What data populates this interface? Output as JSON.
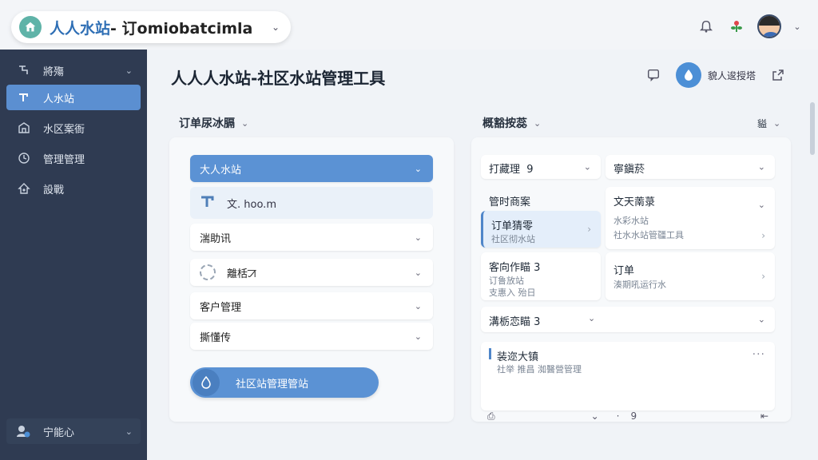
{
  "window": {
    "title_accent": "人人水站",
    "title_rest": "- 订omiobatcimla"
  },
  "sidebar": {
    "items": [
      {
        "label": "將殤",
        "icon": "tap-icon"
      },
      {
        "label": "人水站",
        "icon": "faucet-icon"
      },
      {
        "label": "水区案衙",
        "icon": "building-icon"
      },
      {
        "label": "管理管理",
        "icon": "clock-icon"
      },
      {
        "label": "設戰",
        "icon": "settings-icon"
      }
    ],
    "footer_label": "宁能心"
  },
  "header": {
    "title": "人人人水站-社区水站管理工具",
    "action_label": "貌人逡授塔"
  },
  "left_section": {
    "title": "订单尿冰膈",
    "selected_label": "大人水站",
    "sub_label": "文. hoo.m",
    "rows": [
      "湍助讯",
      "離栝ꠀ",
      "客户管理",
      "撕懂传"
    ],
    "button_label": "社区站管理管站"
  },
  "right_section": {
    "title": "概豁按蕊",
    "corner_label": "貖",
    "top_cards": [
      {
        "label": "打藏理",
        "count": "9"
      },
      {
        "label": "寧鎭菸"
      }
    ],
    "list_header": "管时商案",
    "list_left": [
      {
        "title": "订单猜零",
        "sub1": "社区彻水站"
      },
      {
        "title": "客向作瞄",
        "count": "3",
        "sub1": "订鲁放站",
        "sub2": "支惠入 殆日"
      }
    ],
    "list_right": [
      {
        "title": "文天萳菉",
        "sub1": "水彩水站",
        "sub2": "社水水站管疆工具"
      },
      {
        "title": "订单",
        "sub1": "湊期吼运行水"
      }
    ],
    "mid_card": {
      "label": "溝栃恋瞄",
      "count": "3"
    },
    "detail_card": {
      "title": "装迩大镇",
      "sub": "社举 推昌 洳醫營管理"
    },
    "bottom_left": "",
    "bottom_count": "9"
  }
}
